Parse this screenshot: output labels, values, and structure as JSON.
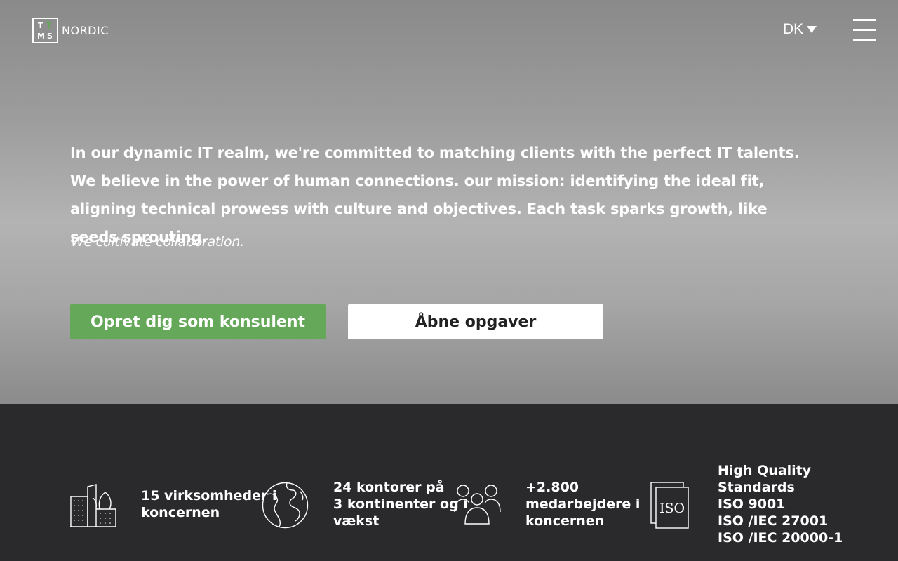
{
  "header": {
    "logo_letters": [
      "T",
      "M",
      "S"
    ],
    "logo_text": "NORDIC",
    "language": "DK",
    "menu_icon": "hamburger-icon"
  },
  "hero": {
    "intro": "In our dynamic IT realm, we're committed to matching clients with the perfect IT talents. We believe in the power of human connections. our mission: identifying the ideal fit, aligning technical prowess with culture and objectives. Each task sparks growth, like seeds sprouting.",
    "tagline": "We cultivate collaboration.",
    "primary_button": "Opret dig som konsulent",
    "secondary_button": "Åbne opgaver"
  },
  "stats": [
    {
      "icon": "buildings-icon",
      "lines": [
        "15 virksomheder i",
        "koncernen"
      ]
    },
    {
      "icon": "globe-icon",
      "lines": [
        "24 kontorer på",
        "3 kontinenter og i",
        "vækst"
      ]
    },
    {
      "icon": "people-icon",
      "lines": [
        "+2.800",
        "medarbejdere i",
        "koncernen"
      ]
    },
    {
      "icon": "iso-certificate-icon",
      "icon_label": "ISO",
      "lines": [
        "High Quality",
        "Standards",
        "ISO 9001",
        "ISO /IEC 27001",
        "ISO /IEC 20000-1"
      ]
    }
  ],
  "colors": {
    "accent_green": "#66a85a",
    "footer_bg": "#2a2a2c"
  }
}
